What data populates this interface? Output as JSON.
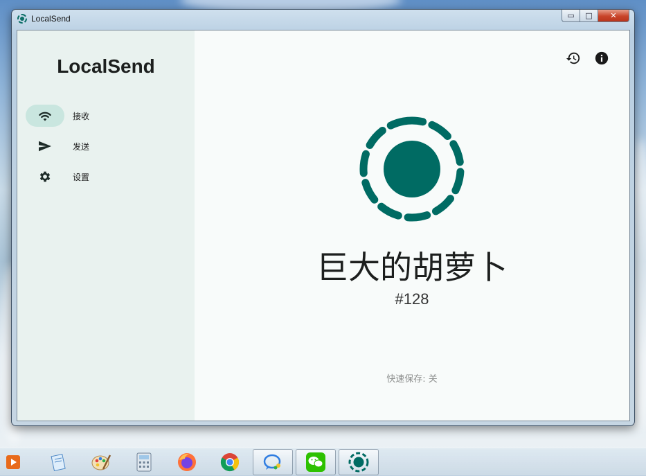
{
  "window": {
    "title": "LocalSend"
  },
  "caption_buttons": {
    "minimize": "▭",
    "maximize": "□",
    "close": "✕"
  },
  "sidebar": {
    "brand": "LocalSend",
    "items": [
      {
        "label": "接收",
        "icon": "wifi-icon",
        "active": true
      },
      {
        "label": "发送",
        "icon": "send-icon",
        "active": false
      },
      {
        "label": "设置",
        "icon": "gear-icon",
        "active": false
      }
    ]
  },
  "main": {
    "device_name": "巨大的胡萝卜",
    "device_id": "#128",
    "quick_save": "快速保存: 关"
  },
  "toolbar": {
    "history_icon": "history-icon",
    "info_icon": "info-icon"
  },
  "colors": {
    "accent": "#006b63",
    "sidebar_bg": "#e9f2ef",
    "main_bg": "#f8fbfa"
  },
  "taskbar": {
    "items": [
      "media-player-icon",
      "notepad-icon",
      "paint-icon",
      "calculator-icon",
      "firefox-icon",
      "chrome-icon",
      "chat-icon",
      "wechat-icon",
      "localsend-icon"
    ]
  }
}
